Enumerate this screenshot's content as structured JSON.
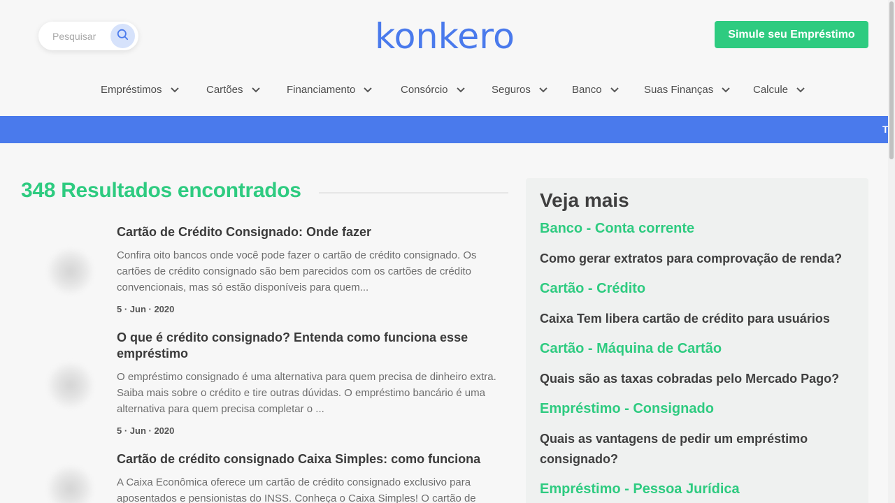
{
  "header": {
    "search": {
      "placeholder": "Pesquisar",
      "icon": "search-icon"
    },
    "logo_text": "konkero",
    "cta_label": "Simule seu Empréstimo",
    "brand_colors": {
      "green": "#2ecb80",
      "blue": "#4a7aec"
    }
  },
  "nav": {
    "items": [
      {
        "label": "Empréstimos"
      },
      {
        "label": "Cartões"
      },
      {
        "label": "Financiamento"
      },
      {
        "label": "Consórcio"
      },
      {
        "label": "Seguros"
      },
      {
        "label": "Banco"
      },
      {
        "label": "Suas Finanças"
      },
      {
        "label": "Calcule"
      }
    ]
  },
  "banner": {
    "text": "T"
  },
  "results": {
    "title": "348 Resultados encontrados",
    "articles": [
      {
        "title": "Cartão de Crédito Consignado: Onde fazer",
        "excerpt": "Confira oito bancos onde você pode fazer o cartão de crédito consignado.  Os cartões de crédito consignado são bem parecidos com os cartões de crédito convencionais, mas só estão disponíveis para quem...",
        "date": "5 · Jun · 2020"
      },
      {
        "title": "O que é crédito consignado? Entenda como funciona esse empréstimo",
        "excerpt": "O empréstimo consignado é uma alternativa para quem precisa de dinheiro extra. Saiba mais sobre o crédito e tire outras dúvidas.  O empréstimo bancário é uma alternativa para quem precisa completar o ...",
        "date": "5 · Jun · 2020"
      },
      {
        "title": "Cartão de crédito consignado Caixa Simples: como funciona",
        "excerpt": "A Caixa Econômica oferece um cartão de crédito consignado exclusivo para aposentados e pensionistas do INSS. Conheça o Caixa Simples!  O cartão de",
        "date": ""
      }
    ]
  },
  "sidebar": {
    "title": "Veja mais",
    "sections": [
      {
        "category": "Banco - Conta corrente",
        "link": "Como gerar extratos para comprovação de renda?"
      },
      {
        "category": "Cartão - Crédito",
        "link": "Caixa Tem libera cartão de crédito para usuários"
      },
      {
        "category": "Cartão - Máquina de Cartão",
        "link": "Quais são as taxas cobradas pelo Mercado Pago?"
      },
      {
        "category": "Empréstimo - Consignado",
        "link": "Quais as vantagens de pedir um empréstimo consignado?"
      },
      {
        "category": "Empréstimo - Pessoa Jurídica",
        "link": ""
      }
    ]
  }
}
